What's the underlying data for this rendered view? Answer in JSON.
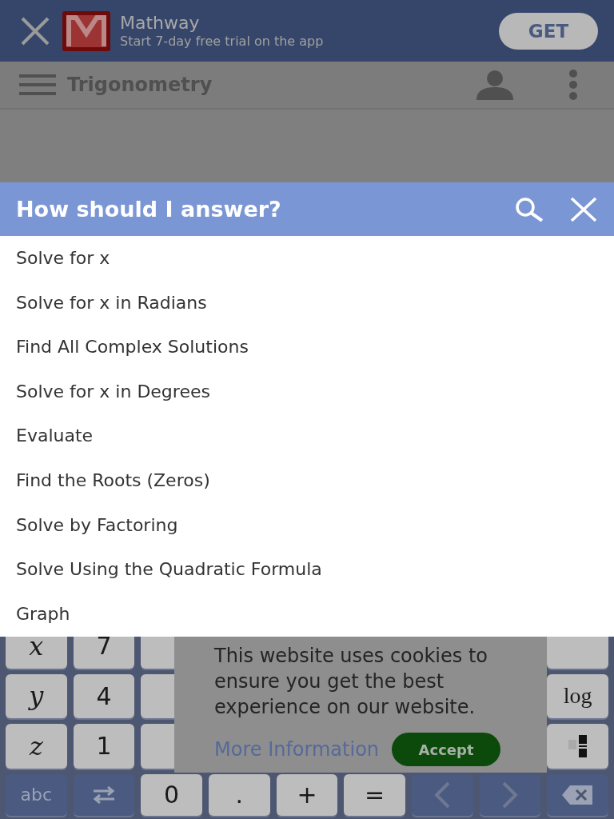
{
  "ad_banner": {
    "title": "Mathway",
    "subtitle": "Start 7-day free trial on the app",
    "button": "GET"
  },
  "app_bar": {
    "title": "Trigonometry"
  },
  "dialog": {
    "title": "How should I answer?",
    "options": [
      "Solve for x",
      "Solve for x in Radians",
      "Find All Complex Solutions",
      "Solve for x in Degrees",
      "Evaluate",
      "Find the Roots (Zeros)",
      "Solve by Factoring",
      "Solve Using the Quadratic Formula",
      "Graph"
    ]
  },
  "keyboard": {
    "rows": [
      [
        {
          "kind": "var",
          "label": "x"
        },
        {
          "kind": "key",
          "label": "7"
        },
        {
          "kind": "blank"
        },
        {
          "kind": "hidden"
        },
        {
          "kind": "hidden"
        },
        {
          "kind": "hidden"
        },
        {
          "kind": "hidden"
        },
        {
          "kind": "hidden"
        },
        {
          "kind": "blank"
        }
      ],
      [
        {
          "kind": "var",
          "label": "y"
        },
        {
          "kind": "key",
          "label": "4"
        },
        {
          "kind": "blank"
        },
        {
          "kind": "hidden"
        },
        {
          "kind": "hidden"
        },
        {
          "kind": "hidden"
        },
        {
          "kind": "hidden"
        },
        {
          "kind": "hidden"
        },
        {
          "kind": "func",
          "label": "log"
        }
      ],
      [
        {
          "kind": "var",
          "label": "z"
        },
        {
          "kind": "key",
          "label": "1"
        },
        {
          "kind": "blank"
        },
        {
          "kind": "hidden"
        },
        {
          "kind": "hidden"
        },
        {
          "kind": "hidden"
        },
        {
          "kind": "hidden"
        },
        {
          "kind": "hidden"
        },
        {
          "kind": "fraction"
        }
      ],
      [
        {
          "kind": "mode",
          "label": "abc"
        },
        {
          "kind": "swap"
        },
        {
          "kind": "key",
          "label": "0"
        },
        {
          "kind": "key",
          "label": "."
        },
        {
          "kind": "key",
          "label": "+"
        },
        {
          "kind": "key",
          "label": "="
        },
        {
          "kind": "left"
        },
        {
          "kind": "right"
        },
        {
          "kind": "backspace"
        }
      ]
    ]
  },
  "cookie_banner": {
    "message": "This website uses cookies to ensure you get the best experience on our website.",
    "link": "More Information",
    "button": "Accept"
  }
}
